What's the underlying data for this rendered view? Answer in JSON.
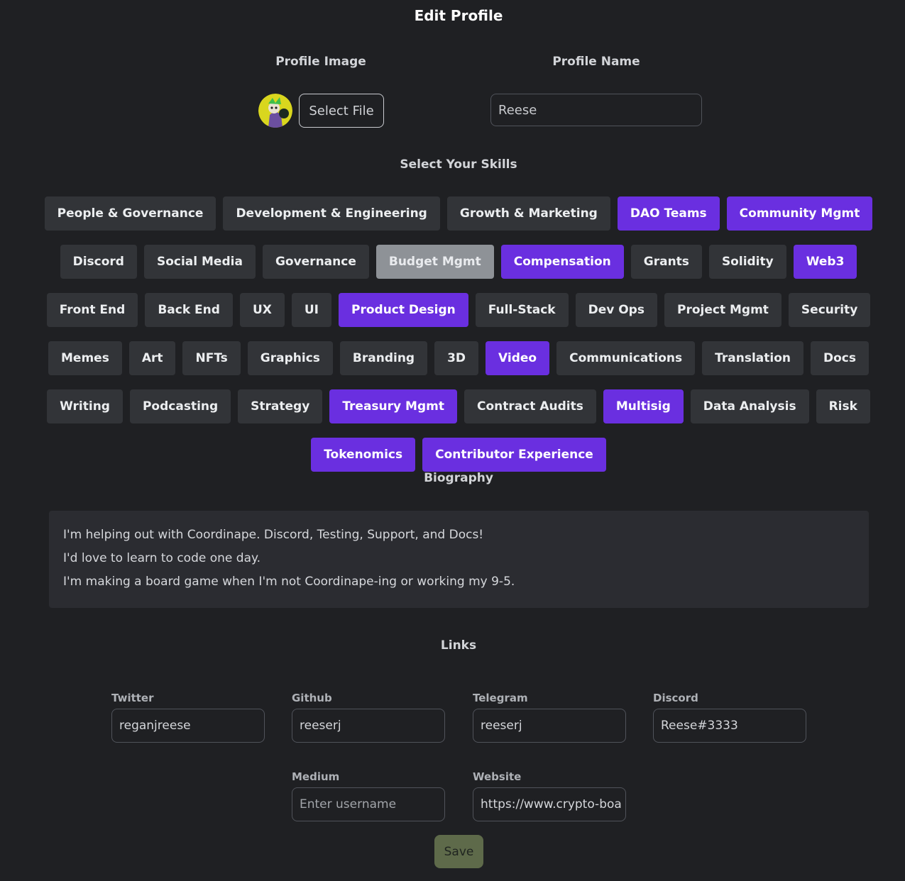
{
  "page": {
    "title": "Edit Profile"
  },
  "profile_image": {
    "label": "Profile Image",
    "select_file_label": "Select File"
  },
  "profile_name": {
    "label": "Profile Name",
    "value": "Reese"
  },
  "skills": {
    "label": "Select Your Skills",
    "rows": [
      [
        {
          "label": "People & Governance",
          "state": "off"
        },
        {
          "label": "Development & Engineering",
          "state": "off"
        },
        {
          "label": "Growth & Marketing",
          "state": "off"
        },
        {
          "label": "DAO Teams",
          "state": "on"
        },
        {
          "label": "Community Mgmt",
          "state": "on"
        }
      ],
      [
        {
          "label": "Discord",
          "state": "off"
        },
        {
          "label": "Social Media",
          "state": "off"
        },
        {
          "label": "Governance",
          "state": "off"
        },
        {
          "label": "Budget Mgmt",
          "state": "dim"
        },
        {
          "label": "Compensation",
          "state": "on"
        },
        {
          "label": "Grants",
          "state": "off"
        },
        {
          "label": "Solidity",
          "state": "off"
        },
        {
          "label": "Web3",
          "state": "on"
        }
      ],
      [
        {
          "label": "Front End",
          "state": "off"
        },
        {
          "label": "Back End",
          "state": "off"
        },
        {
          "label": "UX",
          "state": "off"
        },
        {
          "label": "UI",
          "state": "off"
        },
        {
          "label": "Product Design",
          "state": "on"
        },
        {
          "label": "Full-Stack",
          "state": "off"
        },
        {
          "label": "Dev Ops",
          "state": "off"
        },
        {
          "label": "Project Mgmt",
          "state": "off"
        },
        {
          "label": "Security",
          "state": "off"
        }
      ],
      [
        {
          "label": "Memes",
          "state": "off"
        },
        {
          "label": "Art",
          "state": "off"
        },
        {
          "label": "NFTs",
          "state": "off"
        },
        {
          "label": "Graphics",
          "state": "off"
        },
        {
          "label": "Branding",
          "state": "off"
        },
        {
          "label": "3D",
          "state": "off"
        },
        {
          "label": "Video",
          "state": "on"
        },
        {
          "label": "Communications",
          "state": "off"
        },
        {
          "label": "Translation",
          "state": "off"
        },
        {
          "label": "Docs",
          "state": "off"
        }
      ],
      [
        {
          "label": "Writing",
          "state": "off"
        },
        {
          "label": "Podcasting",
          "state": "off"
        },
        {
          "label": "Strategy",
          "state": "off"
        },
        {
          "label": "Treasury Mgmt",
          "state": "on"
        },
        {
          "label": "Contract Audits",
          "state": "off"
        },
        {
          "label": "Multisig",
          "state": "on"
        },
        {
          "label": "Data Analysis",
          "state": "off"
        },
        {
          "label": "Risk",
          "state": "off"
        }
      ],
      [
        {
          "label": "Tokenomics",
          "state": "on"
        },
        {
          "label": "Contributor Experience",
          "state": "on"
        }
      ]
    ]
  },
  "biography": {
    "label": "Biography",
    "lines": [
      "I'm helping out with Coordinape. Discord, Testing, Support, and Docs!",
      "I'd love to learn to code one day.",
      "I'm making a board game when I'm not Coordinape-ing or working my 9-5."
    ]
  },
  "links": {
    "label": "Links",
    "twitter": {
      "label": "Twitter",
      "value": "reganjreese"
    },
    "github": {
      "label": "Github",
      "value": "reeserj"
    },
    "telegram": {
      "label": "Telegram",
      "value": "reeserj"
    },
    "discord": {
      "label": "Discord",
      "value": "Reese#3333"
    },
    "medium": {
      "label": "Medium",
      "placeholder": "Enter username"
    },
    "website": {
      "label": "Website",
      "value": "https://www.crypto-boa"
    }
  },
  "save_label": "Save",
  "colors": {
    "background": "#1f2023",
    "accent": "#6a2fe0",
    "chip": "#323438",
    "save": "#5e6a4a"
  }
}
